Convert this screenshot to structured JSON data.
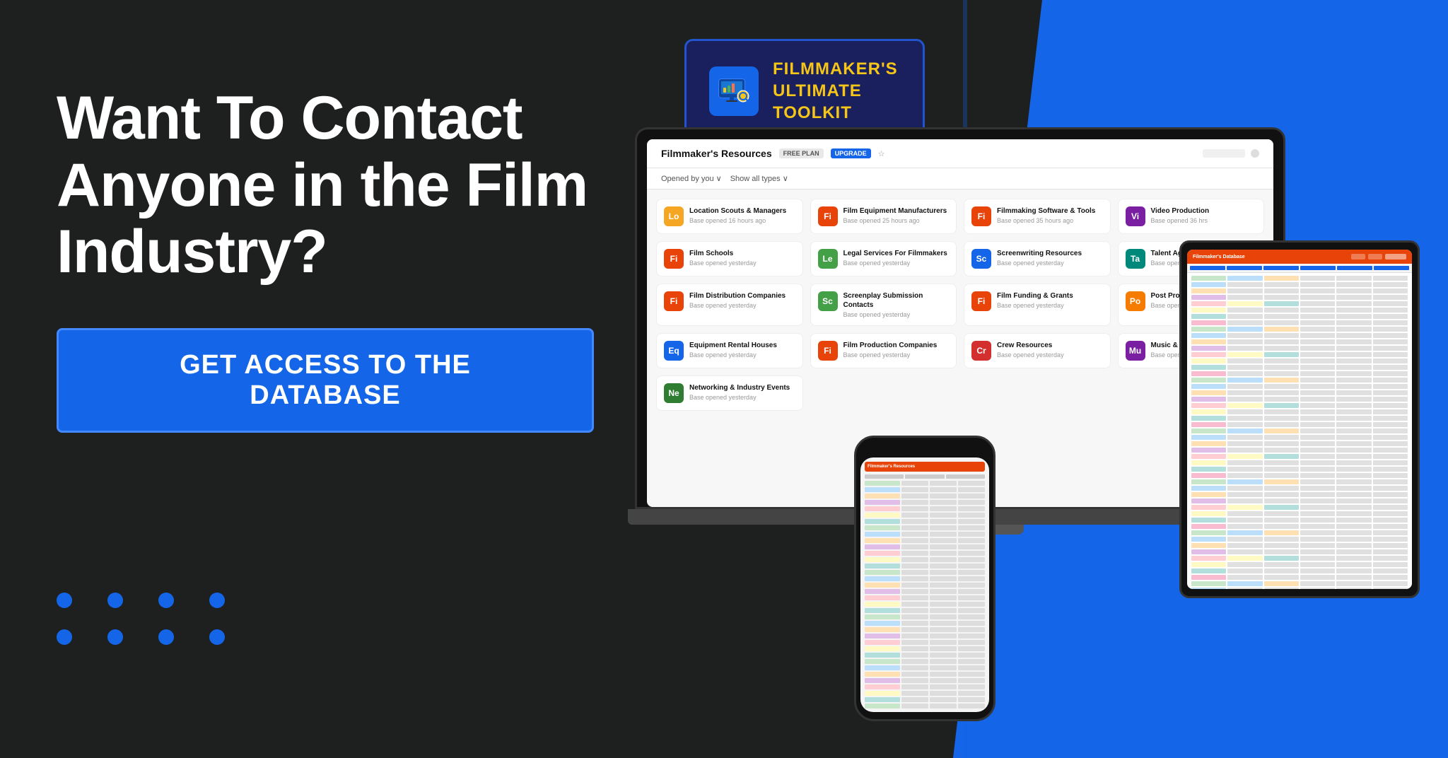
{
  "background": {
    "main_color": "#1e2020",
    "blue_color": "#1565e8"
  },
  "headline": {
    "line1": "Want To Contact",
    "line2": "Anyone in the Film",
    "line3": "Industry?"
  },
  "cta": {
    "label": "GET ACCESS TO THE DATABASE"
  },
  "toolkit": {
    "title_line1": "FILMMAKER'S",
    "title_line2_highlight": "ULTIMATE",
    "title_line3": "TOOLKIT",
    "icon_emoji": "🔍"
  },
  "app": {
    "title": "Filmmaker's Resources",
    "badge_free": "FREE PLAN",
    "badge_upgrade": "UPGRADE",
    "filter1": "Opened by you ∨",
    "filter2": "Show all types ∨",
    "tiles": [
      {
        "icon": "Lo",
        "color": "#f5a623",
        "name": "Location Scouts & Managers",
        "time": "Base opened 16 hours ago"
      },
      {
        "icon": "Fi",
        "color": "#e8440a",
        "name": "Film Equipment Manufacturers",
        "time": "Base opened 25 hours ago"
      },
      {
        "icon": "Fi",
        "color": "#e8440a",
        "name": "Filmmaking Software & Tools",
        "time": "Base opened 35 hours ago"
      },
      {
        "icon": "Vi",
        "color": "#7b1fa2",
        "name": "Video Production",
        "time": "Base opened 36 hrs"
      },
      {
        "icon": "Fi",
        "color": "#e8440a",
        "name": "Film Schools",
        "time": "Base opened yesterday"
      },
      {
        "icon": "Le",
        "color": "#43a047",
        "name": "Legal Services For Filmmakers",
        "time": "Base opened yesterday"
      },
      {
        "icon": "Sc",
        "color": "#1565e8",
        "name": "Screenwriting Resources",
        "time": "Base opened yesterday"
      },
      {
        "icon": "Ta",
        "color": "#00897b",
        "name": "Talent Agents & Directors",
        "time": "Base opened yesterday"
      },
      {
        "icon": "Fi",
        "color": "#e8440a",
        "name": "Film Distribution Companies",
        "time": "Base opened yesterday"
      },
      {
        "icon": "Sc",
        "color": "#43a047",
        "name": "Screenplay Submission Contacts",
        "time": "Base opened yesterday"
      },
      {
        "icon": "Fi",
        "color": "#e8440a",
        "name": "Film Funding & Grants",
        "time": "Base opened yesterday"
      },
      {
        "icon": "Po",
        "color": "#f57c00",
        "name": "Post Production",
        "time": "Base opened yesterday"
      },
      {
        "icon": "Eq",
        "color": "#1565e8",
        "name": "Equipment Rental Houses",
        "time": "Base opened yesterday"
      },
      {
        "icon": "Fi",
        "color": "#e8440a",
        "name": "Film Production Companies",
        "time": "Base opened yesterday"
      },
      {
        "icon": "Cr",
        "color": "#d32f2f",
        "name": "Crew Resources",
        "time": "Base opened yesterday"
      },
      {
        "icon": "Mu",
        "color": "#7b1fa2",
        "name": "Music & Sound Libraries",
        "time": "Base opened yesterday"
      },
      {
        "icon": "Ne",
        "color": "#2e7d32",
        "name": "Networking & Industry Events",
        "time": "Base opened yesterday"
      }
    ]
  },
  "dots": {
    "row1": [
      1,
      2,
      3,
      4
    ],
    "row2": [
      1,
      2,
      3,
      4
    ]
  }
}
